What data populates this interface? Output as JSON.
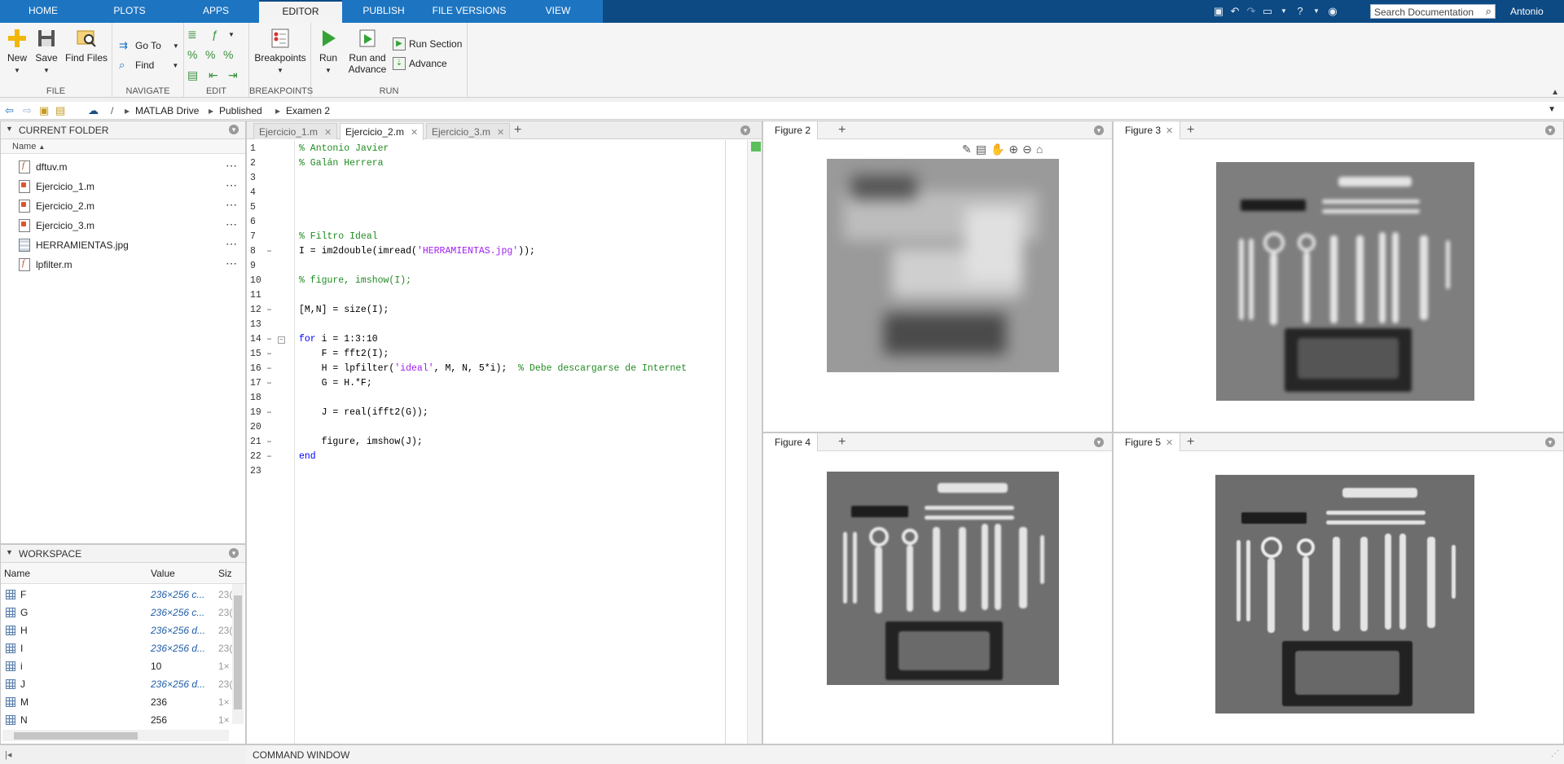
{
  "tabs": [
    "HOME",
    "PLOTS",
    "APPS",
    "EDITOR",
    "PUBLISH",
    "FILE VERSIONS",
    "VIEW"
  ],
  "active_tab": "EDITOR",
  "search": {
    "placeholder": "Search Documentation"
  },
  "user": "Antonio",
  "ribbon": {
    "file": {
      "new": "New",
      "save": "Save",
      "find_files": "Find Files",
      "label": "FILE"
    },
    "navigate": {
      "go_to": "Go To",
      "find": "Find",
      "label": "NAVIGATE"
    },
    "edit": {
      "label": "EDIT"
    },
    "breakpoints": {
      "button": "Breakpoints",
      "label": "BREAKPOINTS"
    },
    "run": {
      "run": "Run",
      "run_and_advance_1": "Run and",
      "run_and_advance_2": "Advance",
      "run_section": "Run Section",
      "advance": "Advance",
      "label": "RUN"
    }
  },
  "address": {
    "root": "/",
    "crumbs": [
      "MATLAB Drive",
      "Published",
      "Examen 2"
    ]
  },
  "current_folder": {
    "title": "CURRENT FOLDER",
    "column": "Name",
    "files": [
      "dftuv.m",
      "Ejercicio_1.m",
      "Ejercicio_2.m",
      "Ejercicio_3.m",
      "HERRAMIENTAS.jpg",
      "lpfilter.m"
    ]
  },
  "workspace": {
    "title": "WORKSPACE",
    "columns": [
      "Name",
      "Value",
      "Siz"
    ],
    "rows": [
      {
        "name": "F",
        "value": "236×256 c...",
        "size": "23("
      },
      {
        "name": "G",
        "value": "236×256 c...",
        "size": "23("
      },
      {
        "name": "H",
        "value": "236×256 d...",
        "size": "23("
      },
      {
        "name": "I",
        "value": "236×256 d...",
        "size": "23("
      },
      {
        "name": "i",
        "value": "10",
        "size": "1×"
      },
      {
        "name": "J",
        "value": "236×256 d...",
        "size": "23("
      },
      {
        "name": "M",
        "value": "236",
        "size": "1×"
      },
      {
        "name": "N",
        "value": "256",
        "size": "1×"
      }
    ]
  },
  "editor": {
    "tabs": [
      "Ejercicio_1.m",
      "Ejercicio_2.m",
      "Ejercicio_3.m"
    ],
    "active": "Ejercicio_2.m",
    "lines": [
      "% Antonio Javier",
      "% Galán Herrera",
      "",
      "",
      "",
      "",
      "% Filtro Ideal",
      "I = im2double(imread('HERRAMIENTAS.jpg'));",
      "",
      "% figure, imshow(I);",
      "",
      "[M,N] = size(I);",
      "",
      "for i = 1:3:10",
      "    F = fft2(I);",
      "    H = lpfilter('ideal', M, N, 5*i);  % Debe descargarse de Internet",
      "    G = H.*F;",
      "",
      "    J = real(ifft2(G));",
      "",
      "    figure, imshow(J);",
      "end",
      ""
    ],
    "executable_lines": [
      8,
      12,
      14,
      15,
      16,
      17,
      19,
      21,
      22
    ]
  },
  "figures": [
    "Figure 2",
    "Figure 3",
    "Figure 4",
    "Figure 5"
  ],
  "command_window": "COMMAND WINDOW"
}
